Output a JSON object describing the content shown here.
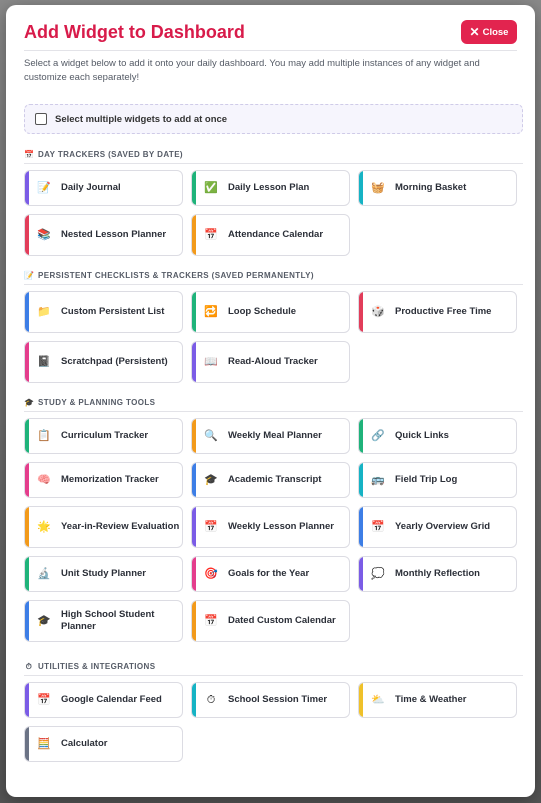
{
  "modal": {
    "title": "Add Widget to Dashboard",
    "close_label": "Close",
    "subtitle": "Select a widget below to add it onto your daily dashboard. You may add multiple instances of any widget and customize each separately!",
    "multi_select_label": "Select multiple widgets to add at once"
  },
  "colors": {
    "title": "#d81b4a",
    "close_button": "#e2244f",
    "purple": "#7b5ce6",
    "green": "#1fb37a",
    "teal": "#16b3c4",
    "red": "#e23d5a",
    "orange": "#f29a1b",
    "blue": "#3d7ee6",
    "pink": "#e43d8c",
    "yellow": "#efc12a",
    "slate": "#6b7385"
  },
  "sections": [
    {
      "title": "DAY TRACKERS (SAVED BY DATE)",
      "icon": "calendar-icon",
      "glyph": "📅",
      "items": [
        {
          "label": "Daily Journal",
          "icon": "memo-icon",
          "glyph": "📝",
          "accent": "#7b5ce6"
        },
        {
          "label": "Daily Lesson Plan",
          "icon": "check-box-icon",
          "glyph": "✅",
          "accent": "#1fb37a"
        },
        {
          "label": "Morning Basket",
          "icon": "basket-icon",
          "glyph": "🧺",
          "accent": "#16b3c4"
        },
        {
          "label": "Nested Lesson Planner",
          "icon": "books-icon",
          "glyph": "📚",
          "accent": "#e23d5a"
        },
        {
          "label": "Attendance Calendar",
          "icon": "calendar-icon",
          "glyph": "📅",
          "accent": "#f29a1b"
        }
      ]
    },
    {
      "title": "PERSISTENT CHECKLISTS & TRACKERS (SAVED PERMANENTLY)",
      "icon": "memo-icon",
      "glyph": "📝",
      "items": [
        {
          "label": "Custom Persistent List",
          "icon": "folder-icon",
          "glyph": "📁",
          "accent": "#3d7ee6"
        },
        {
          "label": "Loop Schedule",
          "icon": "loop-icon",
          "glyph": "🔁",
          "accent": "#1fb37a"
        },
        {
          "label": "Productive Free Time",
          "icon": "dice-icon",
          "glyph": "🎲",
          "accent": "#e23d5a"
        },
        {
          "label": "Scratchpad (Persistent)",
          "icon": "notebook-icon",
          "glyph": "📓",
          "accent": "#e43d8c"
        },
        {
          "label": "Read-Aloud Tracker",
          "icon": "open-book-icon",
          "glyph": "📖",
          "accent": "#7b5ce6"
        }
      ]
    },
    {
      "title": "STUDY & PLANNING TOOLS",
      "icon": "graduation-cap-icon",
      "glyph": "🎓",
      "items": [
        {
          "label": "Curriculum Tracker",
          "icon": "clipboard-icon",
          "glyph": "📋",
          "accent": "#1fb37a"
        },
        {
          "label": "Weekly Meal Planner",
          "icon": "search-food-icon",
          "glyph": "🔍",
          "accent": "#f29a1b"
        },
        {
          "label": "Quick Links",
          "icon": "link-icon",
          "glyph": "🔗",
          "accent": "#1fb37a"
        },
        {
          "label": "Memorization Tracker",
          "icon": "brain-icon",
          "glyph": "🧠",
          "accent": "#e43d8c"
        },
        {
          "label": "Academic Transcript",
          "icon": "graduation-cap-icon",
          "glyph": "🎓",
          "accent": "#3d7ee6"
        },
        {
          "label": "Field Trip Log",
          "icon": "bus-icon",
          "glyph": "🚌",
          "accent": "#16b3c4"
        },
        {
          "label": "Year-in-Review Evaluation",
          "icon": "sun-icon",
          "glyph": "🌟",
          "accent": "#f29a1b"
        },
        {
          "label": "Weekly Lesson Planner",
          "icon": "calendar-icon",
          "glyph": "📅",
          "accent": "#7b5ce6"
        },
        {
          "label": "Yearly Overview Grid",
          "icon": "calendar-icon",
          "glyph": "📅",
          "accent": "#3d7ee6"
        },
        {
          "label": "Unit Study Planner",
          "icon": "microscope-icon",
          "glyph": "🔬",
          "accent": "#1fb37a"
        },
        {
          "label": "Goals for the Year",
          "icon": "target-icon",
          "glyph": "🎯",
          "accent": "#e43d8c"
        },
        {
          "label": "Monthly Reflection",
          "icon": "speech-bubble-icon",
          "glyph": "💭",
          "accent": "#7b5ce6"
        },
        {
          "label": "High School Student Planner",
          "icon": "graduation-cap-icon",
          "glyph": "🎓",
          "accent": "#3d7ee6"
        },
        {
          "label": "Dated Custom Calendar",
          "icon": "calendar-icon",
          "glyph": "📅",
          "accent": "#f29a1b"
        }
      ]
    },
    {
      "title": "UTILITIES & INTEGRATIONS",
      "icon": "stopwatch-icon",
      "glyph": "⏱",
      "items": [
        {
          "label": "Google Calendar Feed",
          "icon": "calendar-icon",
          "glyph": "📅",
          "accent": "#7b5ce6"
        },
        {
          "label": "School Session Timer",
          "icon": "stopwatch-icon",
          "glyph": "⏱",
          "accent": "#16b3c4"
        },
        {
          "label": "Time & Weather",
          "icon": "sun-cloud-icon",
          "glyph": "⛅",
          "accent": "#efc12a"
        },
        {
          "label": "Calculator",
          "icon": "abacus-icon",
          "glyph": "🧮",
          "accent": "#6b7385"
        }
      ]
    }
  ]
}
